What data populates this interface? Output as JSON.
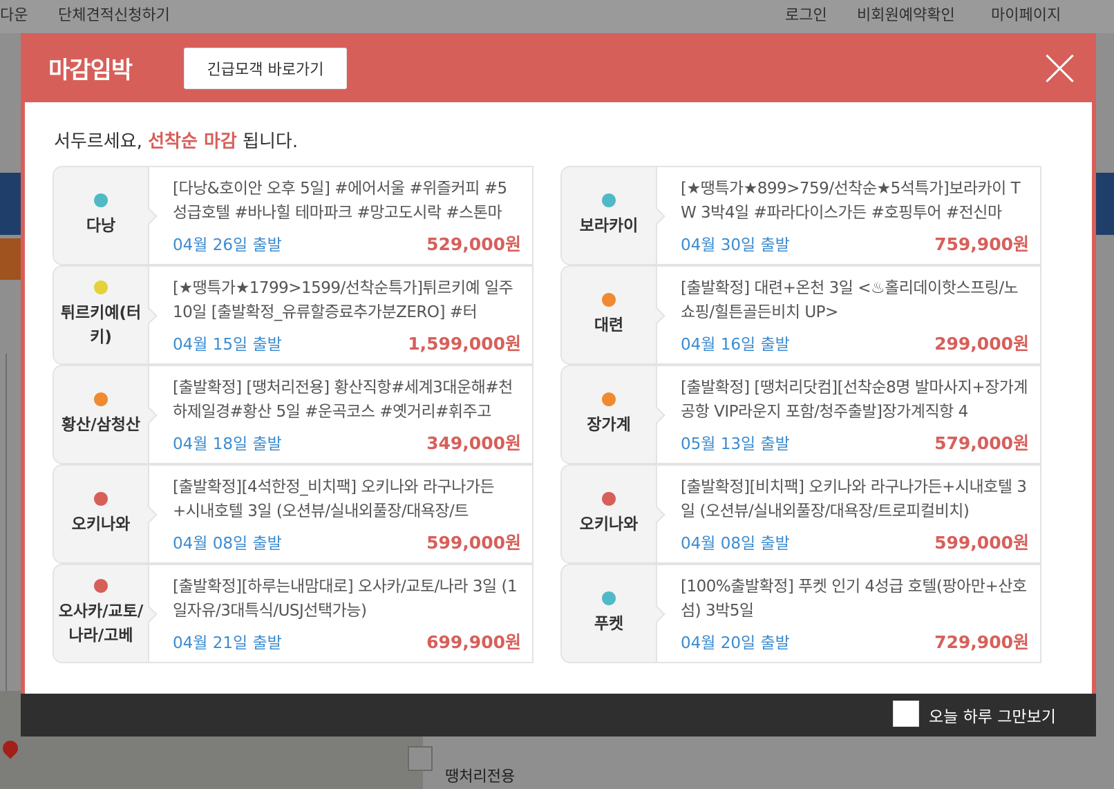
{
  "background": {
    "nav_left": [
      "다운",
      "단체견적신청하기"
    ],
    "nav_right": [
      "로그인",
      "비회원예약확인",
      "마이페이지"
    ],
    "bottom_text": "땡처리전용"
  },
  "popup": {
    "title": "마감임박",
    "urgent_button": "긴급모객 바로가기",
    "notice_prefix": "서두르세요, ",
    "notice_highlight": "선착순 마감",
    "notice_suffix": " 됩니다.",
    "dont_show_label": "오늘 하루 그만보기"
  },
  "colors": {
    "accent": "#d75f5a",
    "date_blue": "#3b8bd0",
    "dot_teal": "#4fb9c6",
    "dot_yellow": "#e4d23c",
    "dot_orange": "#f08a30",
    "dot_red": "#d75f5a"
  },
  "deals_left": [
    {
      "dest": "다낭",
      "dot": "#4fb9c6",
      "title": "[다낭&호이안 오후 5일] #에어서울 #위즐커피 #5성급호텔 #바나힐 테마파크 #망고도시락 #스톤마",
      "date": "04월 26일 출발",
      "price": "529,000원"
    },
    {
      "dest": "튀르키예(터키)",
      "dot": "#e4d23c",
      "title": "[★땡특가★1799>1599/선착순특가]튀르키예 일주 10일 [출발확정_유류할증료추가분ZERO] #터",
      "date": "04월 15일 출발",
      "price": "1,599,000원"
    },
    {
      "dest": "황산/삼청산",
      "dot": "#f08a30",
      "title": "[출발확정] [땡처리전용] 황산직항#세계3대운해#천하제일경#황산 5일 #운곡코스 #옛거리#휘주고",
      "date": "04월 18일 출발",
      "price": "349,000원"
    },
    {
      "dest": "오키나와",
      "dot": "#d75f5a",
      "title": "[출발확정][4석한정_비치팩] 오키나와 라구나가든+시내호텔 3일 (오션뷰/실내외풀장/대욕장/트",
      "date": "04월 08일 출발",
      "price": "599,000원"
    },
    {
      "dest": "오사카/교토/나라/고베",
      "dot": "#d75f5a",
      "title": "[출발확정][하루는내맘대로] 오사카/교토/나라 3일 (1일자유/3대특식/USJ선택가능)",
      "date": "04월 21일 출발",
      "price": "699,900원"
    }
  ],
  "deals_right": [
    {
      "dest": "보라카이",
      "dot": "#4fb9c6",
      "title": "[★땡특가★899>759/선착순★5석특가]보라카이 TW 3박4일 #파라다이스가든 #호핑투어 #전신마",
      "date": "04월 30일 출발",
      "price": "759,900원"
    },
    {
      "dest": "대련",
      "dot": "#f08a30",
      "title": "[출발확정] 대련+온천 3일 <♨홀리데이핫스프링/노쇼핑/힐튼골든비치 UP>",
      "date": "04월 16일 출발",
      "price": "299,000원"
    },
    {
      "dest": "장가계",
      "dot": "#f08a30",
      "title": "[출발확정] [땡처리닷컴][선착순8명 발마사지+장가계공항 VIP라운지 포함/청주출발]장가계직항 4",
      "date": "05월 13일 출발",
      "price": "579,000원"
    },
    {
      "dest": "오키나와",
      "dot": "#d75f5a",
      "title": "[출발확정][비치팩] 오키나와 라구나가든+시내호텔 3일 (오션뷰/실내외풀장/대욕장/트로피컬비치)",
      "date": "04월 08일 출발",
      "price": "599,000원"
    },
    {
      "dest": "푸켓",
      "dot": "#4fb9c6",
      "title": "[100%출발확정] 푸켓 인기 4성급 호텔(팡아만+산호섬) 3박5일",
      "date": "04월 20일 출발",
      "price": "729,900원"
    }
  ]
}
